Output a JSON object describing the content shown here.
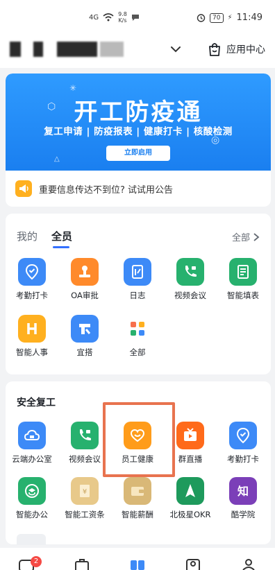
{
  "status_bar": {
    "net_speed_value": "9.8",
    "net_speed_unit": "K/s",
    "signal_label": "4G",
    "battery": "70",
    "time": "11:49"
  },
  "header": {
    "app_center_label": "应用中心"
  },
  "banner": {
    "title": "开工防疫通",
    "subtitle": "复工申请 | 防疫报表 | 健康打卡 | 核酸检测",
    "button_label": "立即启用"
  },
  "notice": {
    "text": "重要信息传达不到位? 试试用公告"
  },
  "apps": {
    "tabs": [
      {
        "label": "我的"
      },
      {
        "label": "全员"
      }
    ],
    "all_label": "全部",
    "items": [
      {
        "label": "考勤打卡",
        "icon": "location-pin-icon",
        "color": "#3d8af7"
      },
      {
        "label": "OA审批",
        "icon": "stamp-icon",
        "color": "#ff8a2b"
      },
      {
        "label": "日志",
        "icon": "notebook-icon",
        "color": "#3d8af7"
      },
      {
        "label": "视频会议",
        "icon": "video-phone-icon",
        "color": "#27b16e"
      },
      {
        "label": "智能填表",
        "icon": "form-icon",
        "color": "#27b16e"
      },
      {
        "label": "智能人事",
        "icon": "h-letter-icon",
        "color": "#ffb01f"
      },
      {
        "label": "宜搭",
        "icon": "yida-icon",
        "color": "#3d8af7"
      },
      {
        "label": "全部",
        "icon": "all-apps-icon",
        "color": "#ffffff"
      }
    ]
  },
  "safety": {
    "title": "安全复工",
    "items": [
      {
        "label": "云端办公室",
        "icon": "cloud-office-icon",
        "color": "#3d8af7"
      },
      {
        "label": "视频会议",
        "icon": "video-phone-icon",
        "color": "#27b16e"
      },
      {
        "label": "员工健康",
        "icon": "heart-icon",
        "color": "#ff9c1a"
      },
      {
        "label": "群直播",
        "icon": "live-tv-icon",
        "color": "#ff6a1a"
      },
      {
        "label": "考勤打卡",
        "icon": "location-pin-icon",
        "color": "#3d8af7"
      },
      {
        "label": "智能办公",
        "icon": "smart-office-icon",
        "color": "#27b16e"
      },
      {
        "label": "智能工资条",
        "icon": "payslip-icon",
        "color": "#e8c98a"
      },
      {
        "label": "智能薪酬",
        "icon": "wallet-icon",
        "color": "#d9b877"
      },
      {
        "label": "北极星OKR",
        "icon": "polaris-icon",
        "color": "#27b16e"
      },
      {
        "label": "酷学院",
        "icon": "zhi-letter-icon",
        "color": "#7b3fb8"
      }
    ]
  },
  "bottom_nav": {
    "badge": "2"
  }
}
